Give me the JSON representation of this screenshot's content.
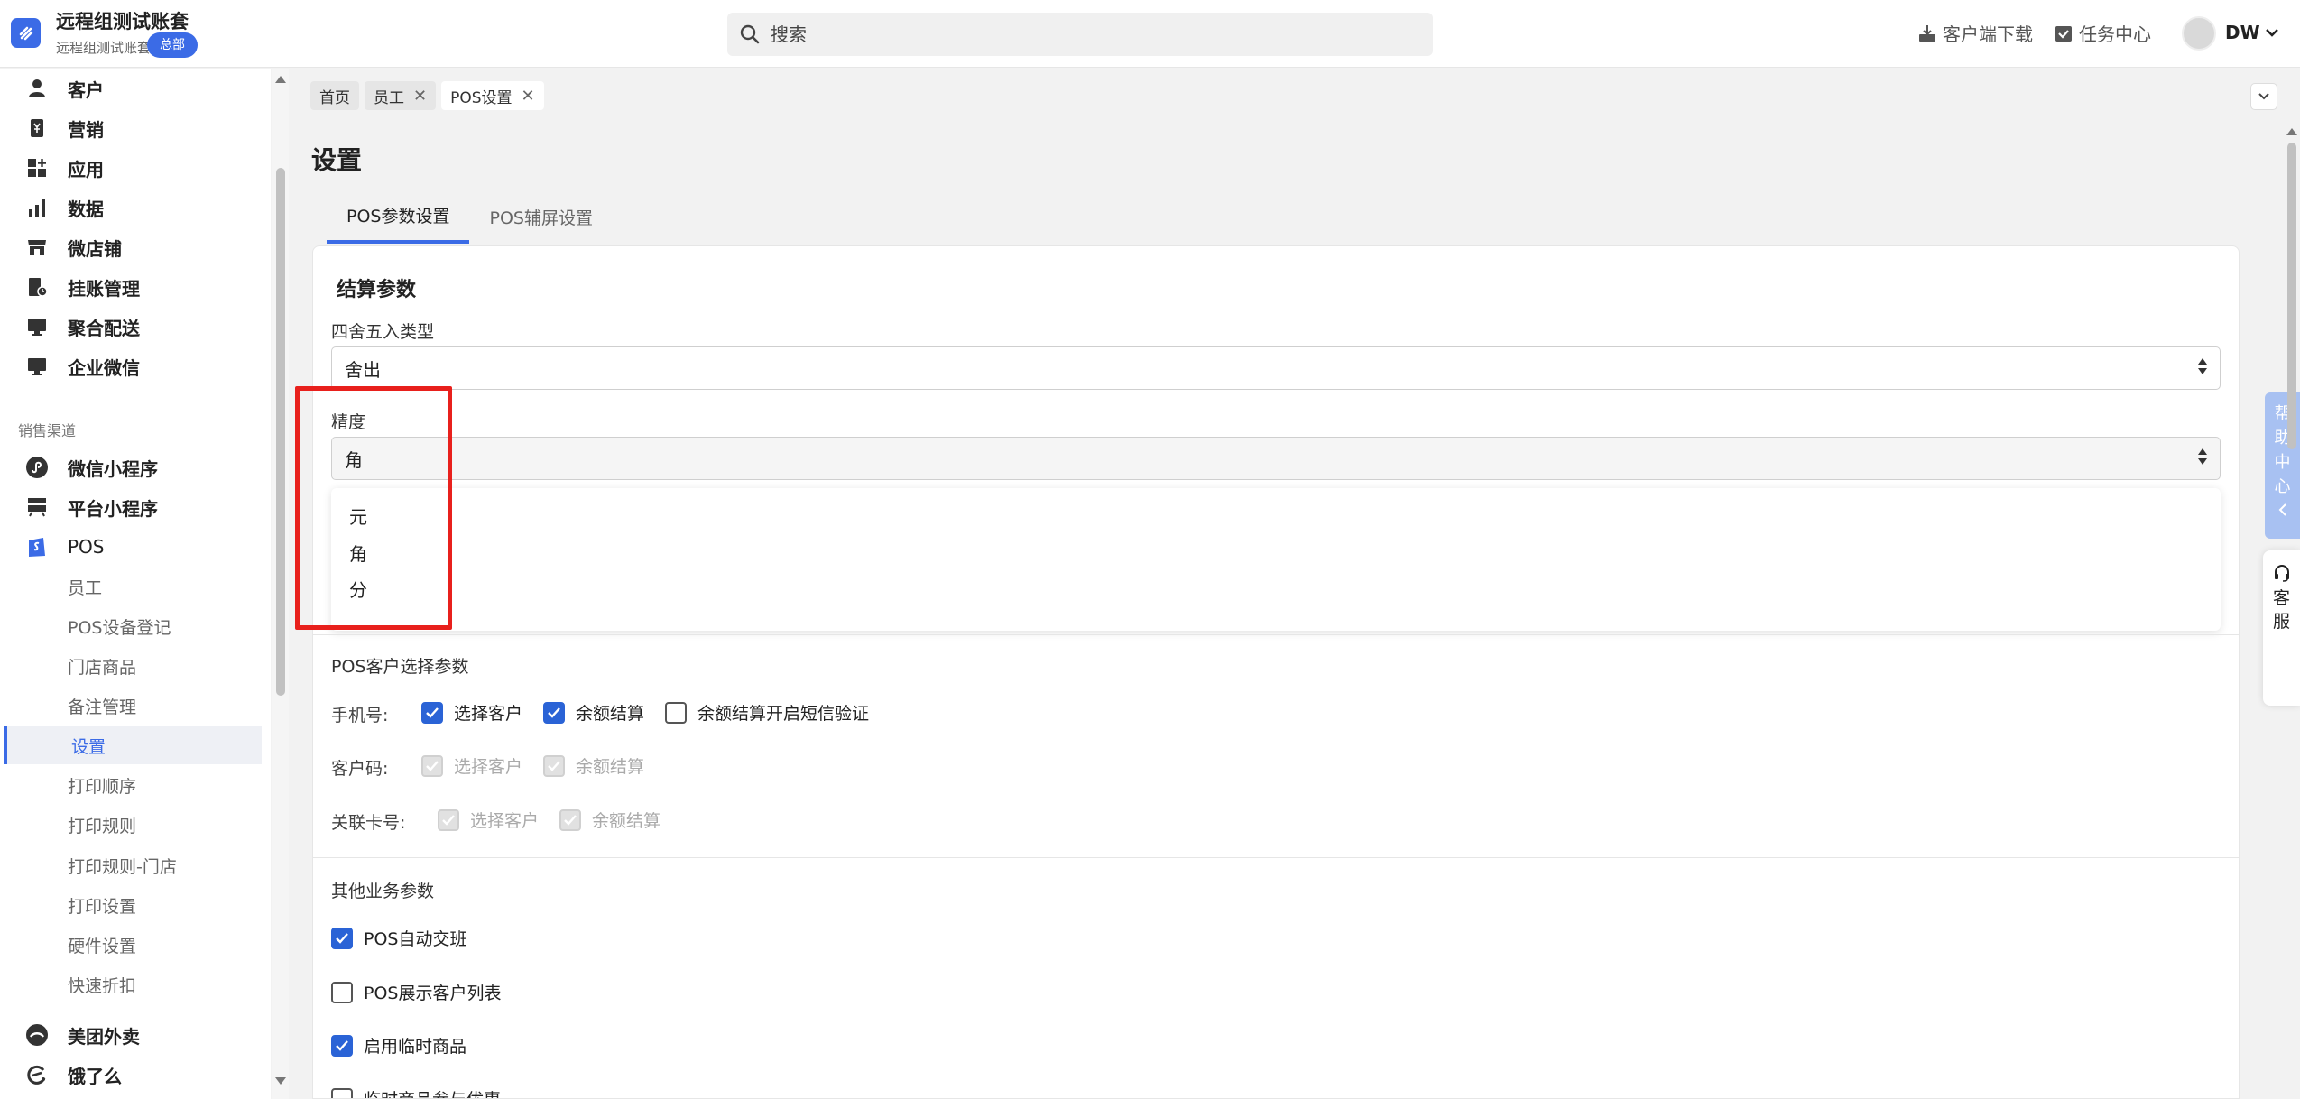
{
  "header": {
    "account_title": "远程组测试账套",
    "account_sub": "远程组测试账套",
    "account_badge": "总部",
    "search_placeholder": "搜索",
    "download_label": "客户端下载",
    "task_label": "任务中心",
    "user_name": "DW"
  },
  "sidebar": {
    "items": [
      {
        "label": "客户",
        "icon": "person-icon"
      },
      {
        "label": "营销",
        "icon": "marketing-icon"
      },
      {
        "label": "应用",
        "icon": "apps-icon"
      },
      {
        "label": "数据",
        "icon": "chart-icon"
      },
      {
        "label": "微店铺",
        "icon": "store-icon"
      },
      {
        "label": "挂账管理",
        "icon": "ledger-icon"
      },
      {
        "label": "聚合配送",
        "icon": "delivery-icon"
      },
      {
        "label": "企业微信",
        "icon": "wecom-icon"
      }
    ],
    "group_label": "销售渠道",
    "channels": [
      {
        "label": "微信小程序",
        "icon": "miniprogram-icon"
      },
      {
        "label": "平台小程序",
        "icon": "platform-icon"
      },
      {
        "label": "POS",
        "icon": "pos-bag-icon"
      }
    ],
    "pos_sub": [
      "员工",
      "POS设备登记",
      "门店商品",
      "备注管理",
      "设置",
      "打印顺序",
      "打印规则",
      "打印规则-门店",
      "打印设置",
      "硬件设置",
      "快速折扣"
    ],
    "active_sub": "设置",
    "more": [
      {
        "label": "美团外卖",
        "icon": "meituan-icon"
      },
      {
        "label": "饿了么",
        "icon": "eleme-icon"
      }
    ]
  },
  "tabs": [
    {
      "label": "首页",
      "closable": false
    },
    {
      "label": "员工",
      "closable": true
    },
    {
      "label": "POS设置",
      "closable": true,
      "active": true
    }
  ],
  "page_title": "设置",
  "subtabs": [
    {
      "label": "POS参数设置",
      "active": true
    },
    {
      "label": "POS辅屏设置",
      "active": false
    }
  ],
  "settlement": {
    "title": "结算参数",
    "rounding_label": "四舍五入类型",
    "rounding_value": "舍出",
    "precision_label": "精度",
    "precision_value": "角",
    "precision_options": [
      "元",
      "角",
      "分"
    ]
  },
  "customer_select": {
    "title": "POS客户选择参数",
    "rows": [
      {
        "label": "手机号:",
        "options": [
          {
            "label": "选择客户",
            "checked": true,
            "disabled": false
          },
          {
            "label": "余额结算",
            "checked": true,
            "disabled": false
          },
          {
            "label": "余额结算开启短信验证",
            "checked": false,
            "disabled": false
          }
        ]
      },
      {
        "label": "客户码:",
        "options": [
          {
            "label": "选择客户",
            "checked": true,
            "disabled": true
          },
          {
            "label": "余额结算",
            "checked": true,
            "disabled": true
          }
        ]
      },
      {
        "label": "关联卡号:",
        "options": [
          {
            "label": "选择客户",
            "checked": true,
            "disabled": true
          },
          {
            "label": "余额结算",
            "checked": true,
            "disabled": true
          }
        ]
      }
    ]
  },
  "other": {
    "title": "其他业务参数",
    "options": [
      {
        "label": "POS自动交班",
        "checked": true
      },
      {
        "label": "POS展示客户列表",
        "checked": false
      },
      {
        "label": "启用临时商品",
        "checked": true
      },
      {
        "label": "临时商品参与优惠",
        "checked": false
      }
    ]
  },
  "floating": {
    "help": [
      "帮",
      "助",
      "中",
      "心"
    ],
    "service": [
      "客",
      "服"
    ]
  },
  "colors": {
    "accent": "#3b6be6",
    "highlight": "#e8201c"
  }
}
